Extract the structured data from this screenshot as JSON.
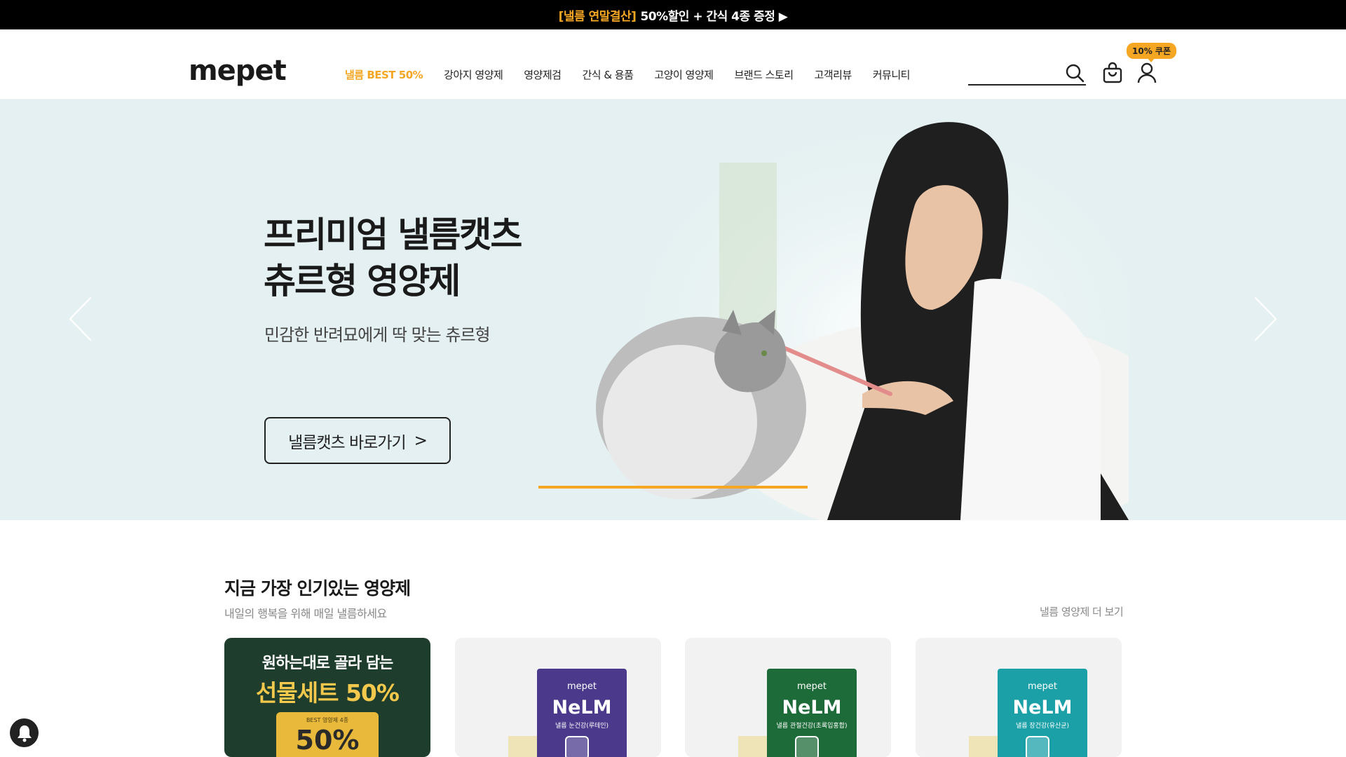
{
  "promo_bar": {
    "accent": "[낼름 연말결산]",
    "text": "50%할인 + 간식 4종 증정 ▶"
  },
  "header": {
    "logo": "mepet",
    "nav": [
      {
        "label": "낼름 BEST 50%",
        "active": true
      },
      {
        "label": "강아지 영양제",
        "active": false
      },
      {
        "label": "영양제검",
        "active": false
      },
      {
        "label": "간식 & 용품",
        "active": false
      },
      {
        "label": "고양이 영양제",
        "active": false
      },
      {
        "label": "브랜드 스토리",
        "active": false
      },
      {
        "label": "고객리뷰",
        "active": false
      },
      {
        "label": "커뮤니티",
        "active": false
      }
    ],
    "search": {
      "value": "",
      "placeholder": "",
      "icon": "search-icon"
    },
    "cart_icon": "cart-icon",
    "user_icon": "user-icon",
    "coupon_badge": "10% 쿠폰"
  },
  "hero": {
    "title_line1": "프리미엄 낼름캣츠",
    "title_line2": "츄르형 영양제",
    "subtitle": "민감한 반려묘에게 딱 맞는 츄르형",
    "button_label": "낼름캣츠 바로가기",
    "button_chevron": ">",
    "slide_progress": 1.0,
    "colors": {
      "background": "#e4f0f1",
      "accent": "#f5a623"
    }
  },
  "section": {
    "title": "지금 가장 인기있는 영양제",
    "subtitle": "내일의 행복을 위해 매일 낼름하세요",
    "more_link": "낼름 영양제 더 보기"
  },
  "cards": [
    {
      "type": "promo",
      "line1": "원하는대로 골라 담는",
      "line2": "선물세트 50%",
      "ticket_small": "BEST 영양제 4종",
      "ticket_big": "50%"
    },
    {
      "type": "product",
      "brand": "mepet",
      "name": "NeLM",
      "desc": "낼름 눈건강(루테인)",
      "color": "#4b3a8c"
    },
    {
      "type": "product",
      "brand": "mepet",
      "name": "NeLM",
      "desc": "낼름 관절건강(초록입홍합)",
      "color": "#1e6b3a"
    },
    {
      "type": "product",
      "brand": "mepet",
      "name": "NeLM",
      "desc": "낼름 장건강(유산균)",
      "color": "#1ba0a8"
    }
  ],
  "floating": {
    "bell_icon": "bell-icon"
  }
}
